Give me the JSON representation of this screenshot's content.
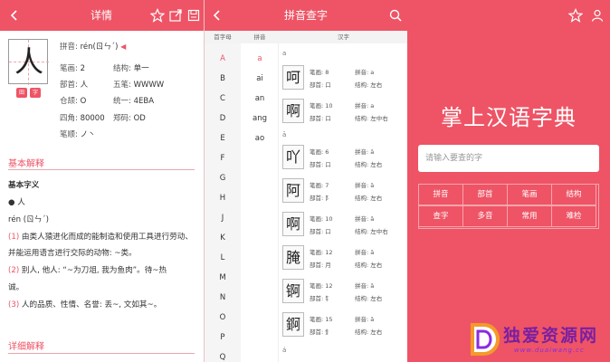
{
  "colors": {
    "accent": "#ee5465",
    "white": "#ffffff"
  },
  "detail": {
    "header": {
      "title": "详情",
      "icons": [
        "back-arrow-icon",
        "star-icon",
        "share-icon",
        "save-icon"
      ]
    },
    "character": "人",
    "buttons": [
      "田",
      "字"
    ],
    "pinyin_label": "拼音:",
    "pinyin_value": "rén(ㄖㄣˊ)",
    "rows": [
      {
        "k1": "笔画:",
        "v1": "2",
        "k2": "结构:",
        "v2": "单一"
      },
      {
        "k1": "部首:",
        "v1": "人",
        "k2": "五笔:",
        "v2": "WWWW"
      },
      {
        "k1": "仓颉:",
        "v1": "O",
        "k2": "统一:",
        "v2": "4EBA"
      },
      {
        "k1": "四角:",
        "v1": "80000",
        "k2": "郑码:",
        "v2": "OD"
      },
      {
        "k1": "笔顺:",
        "v1": "ノ丶",
        "k2": "",
        "v2": ""
      }
    ],
    "basic_title": "基本解释",
    "basic_sub": "基本字义",
    "bullet_char": "● 人",
    "pron": "rén (ㄖㄣˊ)",
    "defs": [
      {
        "n": "(1)",
        "t": " 由类人猿进化而成的能制造和使用工具进行劳动、"
      },
      {
        "n": "",
        "t": "并能运用语言进行交际的动物: ~类。"
      },
      {
        "n": "(2)",
        "t": " 别人, 他人: “~为刀俎, 我为鱼肉”。待~热"
      },
      {
        "n": "",
        "t": "诚。"
      },
      {
        "n": "(3)",
        "t": " 人的品质、性情、名誉: 丢~, 文如其~。"
      }
    ],
    "detail_title": "详细解释"
  },
  "pinyin_page": {
    "header": {
      "title": "拼音查字",
      "icons": [
        "back-arrow-icon",
        "search-icon"
      ]
    },
    "col_heads": [
      "首字母",
      "拼音",
      "汉字"
    ],
    "alphabet": [
      "A",
      "B",
      "C",
      "D",
      "E",
      "F",
      "G",
      "H",
      "J",
      "K",
      "L",
      "M",
      "N",
      "O",
      "P",
      "Q"
    ],
    "pinyin": [
      "a",
      "ai",
      "an",
      "ang",
      "ao"
    ],
    "groups": [
      "a",
      "ā",
      "á"
    ],
    "chars": [
      {
        "c": "呵",
        "bh": "笔画: 8",
        "py": "拼音: a",
        "bs": "部首: 口",
        "jg": "结构: 左右"
      },
      {
        "c": "啊",
        "bh": "笔画: 10",
        "py": "拼音: a",
        "bs": "部首: 口",
        "jg": "结构: 左中右"
      },
      {
        "c": "吖",
        "bh": "笔画: 6",
        "py": "拼音: ā",
        "bs": "部首: 口",
        "jg": "结构: 左右"
      },
      {
        "c": "阿",
        "bh": "笔画: 7",
        "py": "拼音: ā",
        "bs": "部首: 阝",
        "jg": "结构: 左右"
      },
      {
        "c": "啊",
        "bh": "笔画: 10",
        "py": "拼音: ā",
        "bs": "部首: 口",
        "jg": "结构: 左中右"
      },
      {
        "c": "腌",
        "bh": "笔画: 12",
        "py": "拼音: ā",
        "bs": "部首: 月",
        "jg": "结构: 左右"
      },
      {
        "c": "锕",
        "bh": "笔画: 12",
        "py": "拼音: ā",
        "bs": "部首: 钅",
        "jg": "结构: 左右"
      },
      {
        "c": "錒",
        "bh": "笔画: 15",
        "py": "拼音: ā",
        "bs": "部首: 釒",
        "jg": "结构: 左右"
      }
    ]
  },
  "home": {
    "header": {
      "icons": [
        "star-icon",
        "user-icon"
      ]
    },
    "title": "掌上汉语字典",
    "search_placeholder": "请输入要查的字",
    "grid": [
      "拼音",
      "部首",
      "笔画",
      "结构",
      "查字",
      "多音",
      "常用",
      "难检"
    ]
  },
  "watermark": {
    "text": "独爱资源网",
    "url": "www.duaiwang.cc"
  }
}
